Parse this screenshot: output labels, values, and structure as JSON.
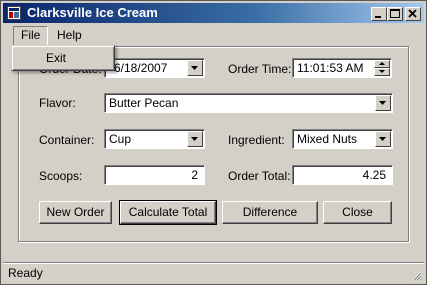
{
  "window": {
    "title": "Clarksville Ice Cream"
  },
  "menu": {
    "file": "File",
    "help": "Help",
    "file_items": [
      "Exit"
    ]
  },
  "form": {
    "order_date_label": "Order Date:",
    "order_date_value": "6/18/2007",
    "order_time_label": "Order Time:",
    "order_time_value": "11:01:53 AM",
    "flavor_label": "Flavor:",
    "flavor_value": "Butter Pecan",
    "container_label": "Container:",
    "container_value": "Cup",
    "ingredient_label": "Ingredient:",
    "ingredient_value": "Mixed Nuts",
    "scoops_label": "Scoops:",
    "scoops_value": "2",
    "order_total_label": "Order Total:",
    "order_total_value": "4.25"
  },
  "buttons": {
    "new_order": "New Order",
    "calculate_total": "Calculate Total",
    "difference": "Difference",
    "close": "Close"
  },
  "status": {
    "text": "Ready"
  }
}
